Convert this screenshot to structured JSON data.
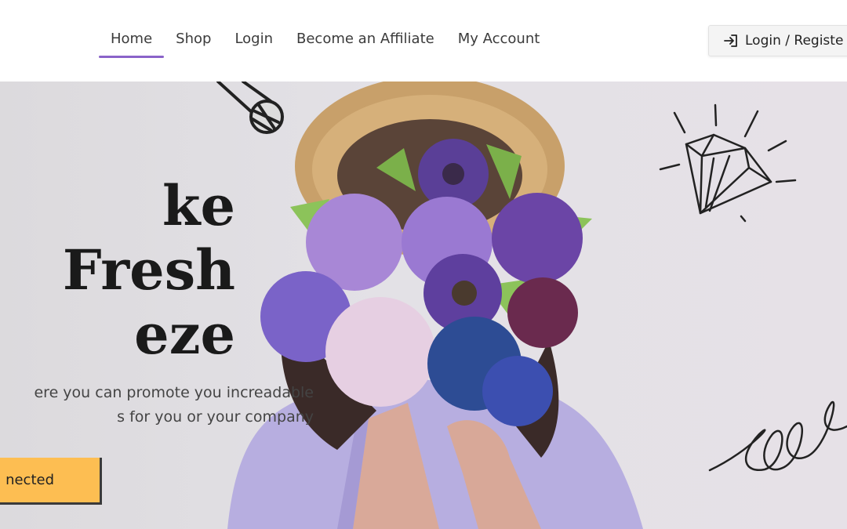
{
  "nav": {
    "items": [
      {
        "label": "Home",
        "active": true
      },
      {
        "label": "Shop",
        "active": false
      },
      {
        "label": "Login",
        "active": false
      },
      {
        "label": "Become an Affiliate",
        "active": false
      },
      {
        "label": "My Account",
        "active": false
      }
    ],
    "login_register_label": "Login / Registe",
    "login_icon": "sign-in-icon"
  },
  "hero": {
    "headline_lines": [
      "ke",
      "Fresh",
      "eze"
    ],
    "subtext_lines": [
      "ere you can promote you increadable",
      "s for you or your company"
    ],
    "cta_label": "nected"
  },
  "colors": {
    "accent": "#8a63c9",
    "cta": "#fdbe52",
    "hero_bg": "#e3e1e6"
  }
}
